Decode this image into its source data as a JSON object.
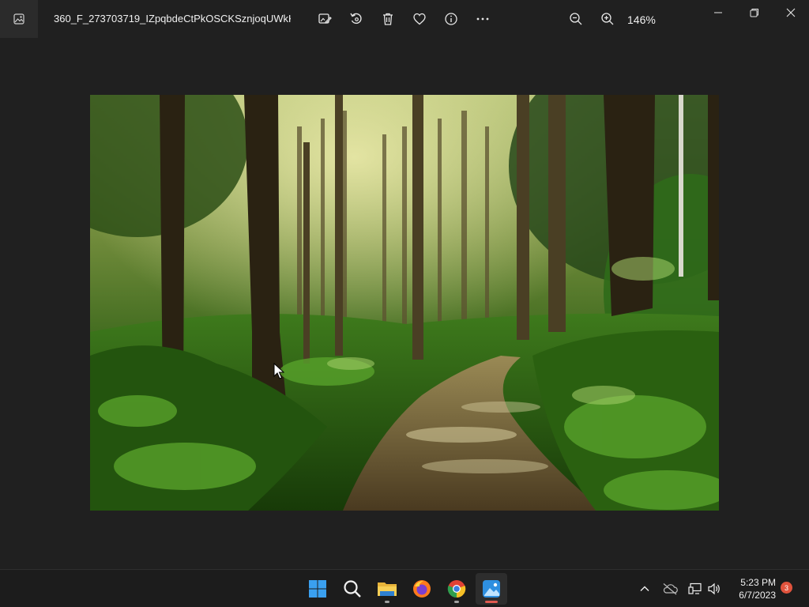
{
  "window": {
    "title": "360_F_273703719_IZpqbdeCtPkOSCKSznjoqUWkKW...",
    "zoom": "146%"
  },
  "toolbar": {
    "items": [
      {
        "icon": "edit-image-icon"
      },
      {
        "icon": "rotate-icon"
      },
      {
        "icon": "delete-icon"
      },
      {
        "icon": "favorite-heart-icon"
      },
      {
        "icon": "info-icon"
      },
      {
        "icon": "more-options-icon"
      }
    ]
  },
  "viewer": {
    "image_subject": "forest-path-photo"
  },
  "taskbar": {
    "apps": [
      {
        "icon": "windows-start-icon"
      },
      {
        "icon": "search-icon"
      },
      {
        "icon": "file-explorer-icon",
        "running": true
      },
      {
        "icon": "firefox-icon"
      },
      {
        "icon": "chrome-icon",
        "running": true
      },
      {
        "icon": "photos-app-icon",
        "active": true
      }
    ],
    "tray": {
      "time": "5:23 PM",
      "date": "6/7/2023",
      "notifications": "3"
    }
  },
  "colors": {
    "background": "#202020",
    "taskbar": "#1c1c1c",
    "accent_indicator": "#e05a50",
    "badge": "#e0533d"
  }
}
